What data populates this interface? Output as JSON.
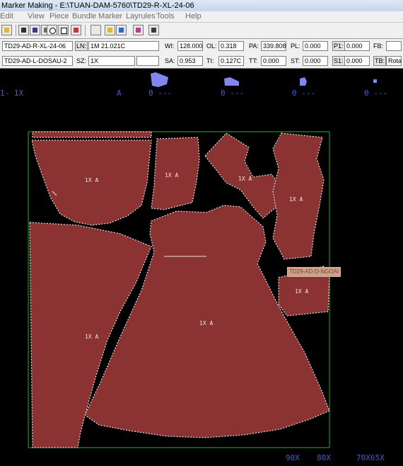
{
  "window": {
    "title": "Marker Making - E:\\TUAN-DAM-5760\\TD29-R-XL-24-06"
  },
  "menu": [
    "Edit",
    "View",
    "Piece",
    "Bundle",
    "Marker",
    "Layrules",
    "Tools",
    "Help"
  ],
  "toolbar": {
    "icons": [
      "open-folder-icon",
      "save-icon",
      "save-as-icon",
      "print-icon",
      "zoom-icon",
      "zoom-window-icon",
      "grid-icon",
      "folder-add-icon",
      "add-pieces-icon",
      "notch-icon",
      "rotate-icon"
    ]
  },
  "info": {
    "marker_name": "TD29-AD-R-XL-24-06",
    "model_name": "TD29-AD-L-DOSAU-2",
    "ln_label": "LN:",
    "ln_value": "1M 21.021C",
    "sz_label": "SZ:",
    "sz_value": "1X",
    "wi_label": "WI:",
    "wi_value": "128.000",
    "ol_label": "OL:",
    "ol_value": "0.318",
    "pa_label": "PA:",
    "pa_value": "339.808",
    "pl_label": "PL:",
    "pl_value": "0.000",
    "p1_label": "P1:",
    "p1_value": "0.000",
    "fb_label": "FB:",
    "fb_value": "",
    "sa_label": "SA:",
    "sa_value": "0.953",
    "ti_label": "TI:",
    "ti_value": "0.127C",
    "tt_label": "TT:",
    "tt_value": "0.000",
    "st_label": "ST:",
    "st_value": "0.000",
    "s1_label": "S1:",
    "s1_value": "0.000",
    "tb_label": "TB:",
    "tb_value": "Rotate"
  },
  "ruler_top": [
    {
      "text": "1- 1X",
      "kind": "size"
    },
    {
      "text": "A",
      "kind": "size"
    },
    {
      "text": "0 ---",
      "kind": "count"
    },
    {
      "text": "0 ---",
      "kind": "count"
    },
    {
      "text": "0 ---",
      "kind": "count"
    },
    {
      "text": "0 ---",
      "kind": "count"
    }
  ],
  "pieces": [
    {
      "label": "1X A"
    },
    {
      "label": "1X A"
    },
    {
      "label": "1X A"
    },
    {
      "label": "1X A"
    },
    {
      "label": "1X A"
    },
    {
      "label": "1X A"
    },
    {
      "label": "1X A"
    }
  ],
  "tooltip": "TD29-AD-D-NGOAI",
  "ruler_bottom": [
    "90X",
    "80X",
    "70X65X"
  ],
  "colors": {
    "piece_fill": "#8b3232",
    "piece_outline": "#e8e0e0",
    "marker_border": "#22b322",
    "ruler_text": "#4a5ad6",
    "background": "#000000"
  }
}
